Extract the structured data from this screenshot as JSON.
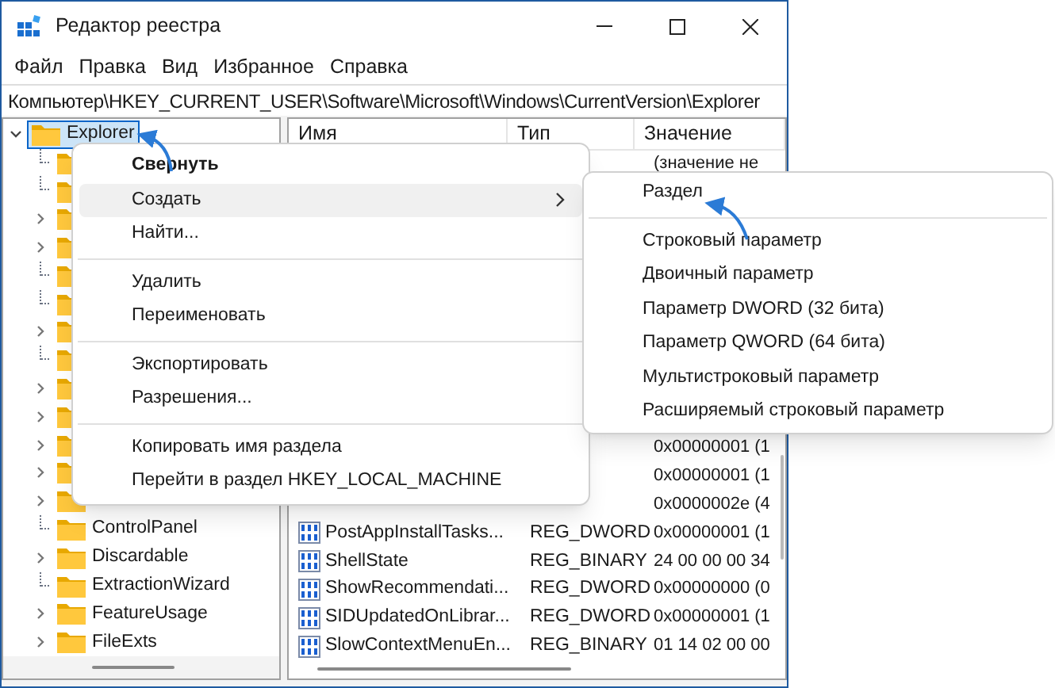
{
  "window": {
    "title": "Редактор реестра"
  },
  "menu_bar": [
    "Файл",
    "Правка",
    "Вид",
    "Избранное",
    "Справка"
  ],
  "address_bar": {
    "value": "Компьютер\\HKEY_CURRENT_USER\\Software\\Microsoft\\Windows\\CurrentVersion\\Explorer"
  },
  "tree": [
    {
      "name": "Explorer",
      "expandable": true,
      "expanded": true,
      "selected": true,
      "children": [
        {
          "expandable": false,
          "expanded": false,
          "selected": false
        },
        {
          "expandable": false,
          "expanded": false,
          "selected": false
        },
        {
          "expandable": true,
          "expanded": false,
          "selected": false
        },
        {
          "expandable": true,
          "expanded": false,
          "selected": false
        },
        {
          "expandable": false,
          "expanded": false,
          "selected": false
        },
        {
          "expandable": false,
          "expanded": false,
          "selected": false
        },
        {
          "expandable": true,
          "expanded": false,
          "selected": false
        },
        {
          "expandable": false,
          "expanded": false,
          "selected": false
        },
        {
          "expandable": true,
          "expanded": false,
          "selected": false
        },
        {
          "expandable": true,
          "expanded": false,
          "selected": false
        },
        {
          "expandable": true,
          "expanded": false,
          "selected": false
        },
        {
          "expandable": true,
          "expanded": false,
          "selected": false
        },
        {
          "expandable": true,
          "expanded": false,
          "selected": false
        },
        {
          "name": "ControlPanel",
          "expandable": false,
          "expanded": false,
          "selected": false
        },
        {
          "name": "Discardable",
          "expandable": true,
          "expanded": false,
          "selected": false
        },
        {
          "name": "ExtractionWizard",
          "expandable": false,
          "expanded": false,
          "selected": false
        },
        {
          "name": "FeatureUsage",
          "expandable": true,
          "expanded": false,
          "selected": false
        },
        {
          "name": "FileExts",
          "expandable": true,
          "expanded": false,
          "selected": false
        }
      ]
    }
  ],
  "values_table": {
    "columns": [
      "Имя",
      "Тип",
      "Значение"
    ],
    "rows": [
      {
        "value": "(значение не"
      },
      {},
      {},
      {},
      {},
      {},
      {},
      {},
      {},
      {},
      {
        "value": "0x00000001 (1"
      },
      {
        "value": "0x00000001 (1"
      },
      {
        "value": "0x0000002e (4"
      },
      {
        "name": "PostAppInstallTasks...",
        "type": "REG_DWORD",
        "value": "0x00000001 (1"
      },
      {
        "name": "ShellState",
        "type": "REG_BINARY",
        "value": "24 00 00 00 34"
      },
      {
        "name": "ShowRecommendati...",
        "type": "REG_DWORD",
        "value": "0x00000000 (0"
      },
      {
        "name": "SIDUpdatedOnLibrar...",
        "type": "REG_DWORD",
        "value": "0x00000001 (1"
      },
      {
        "name": "SlowContextMenuEn...",
        "type": "REG_BINARY",
        "value": "01 14 02 00 00"
      }
    ]
  },
  "context_menu": {
    "items": [
      {
        "kind": "default",
        "label": "Свернуть",
        "selected": false
      },
      {
        "kind": "submenu",
        "label": "Создать",
        "selected": true
      },
      {
        "kind": "item",
        "label": "Найти...",
        "selected": false
      },
      {
        "kind": "separator"
      },
      {
        "kind": "item",
        "label": "Удалить",
        "selected": false
      },
      {
        "kind": "item",
        "label": "Переименовать",
        "selected": false
      },
      {
        "kind": "separator"
      },
      {
        "kind": "item",
        "label": "Экспортировать",
        "selected": false
      },
      {
        "kind": "item",
        "label": "Разрешения...",
        "selected": false
      },
      {
        "kind": "separator"
      },
      {
        "kind": "item",
        "label": "Копировать имя раздела",
        "selected": false
      },
      {
        "kind": "item",
        "label": "Перейти в раздел HKEY_LOCAL_MACHINE",
        "selected": false
      }
    ]
  },
  "submenu": {
    "items": [
      {
        "kind": "item",
        "label": "Раздел",
        "selected": false
      },
      {
        "kind": "separator"
      },
      {
        "kind": "item",
        "label": "Строковый параметр",
        "selected": false
      },
      {
        "kind": "item",
        "label": "Двоичный параметр",
        "selected": false
      },
      {
        "kind": "item",
        "label": "Параметр DWORD (32 бита)",
        "selected": false
      },
      {
        "kind": "item",
        "label": "Параметр QWORD (64 бита)",
        "selected": false
      },
      {
        "kind": "item",
        "label": "Мультистроковый параметр",
        "selected": false
      },
      {
        "kind": "item",
        "label": "Расширяемый строковый параметр",
        "selected": false
      }
    ]
  }
}
